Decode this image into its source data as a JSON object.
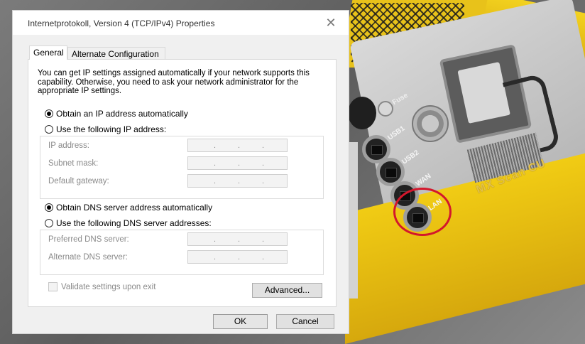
{
  "background": {
    "labels": {
      "fuse": "Fuse",
      "usb1": "USB1",
      "usb2": "USB2",
      "wan": "WAN",
      "lan": "LAN",
      "brand": "MX Scan CU"
    },
    "highlight_color": "#d3172c",
    "case_color": "#f2cf18"
  },
  "dialog": {
    "title": "Internetprotokoll, Version 4 (TCP/IPv4) Properties",
    "close_icon": "close-icon",
    "tabs": [
      {
        "label": "General",
        "active": true
      },
      {
        "label": "Alternate Configuration",
        "active": false
      }
    ],
    "intro": "You can get IP settings assigned automatically if your network supports this capability. Otherwise, you need to ask your network administrator for the appropriate IP settings.",
    "ip_options": {
      "auto": {
        "label": "Obtain an IP address automatically",
        "checked": true
      },
      "manual": {
        "label": "Use the following IP address:",
        "checked": false
      }
    },
    "ip_fields": [
      {
        "label": "IP address:",
        "value": ". . ."
      },
      {
        "label": "Subnet mask:",
        "value": ". . ."
      },
      {
        "label": "Default gateway:",
        "value": ". . ."
      }
    ],
    "dns_options": {
      "auto": {
        "label": "Obtain DNS server address automatically",
        "checked": true
      },
      "manual": {
        "label": "Use the following DNS server addresses:",
        "checked": false
      }
    },
    "dns_fields": [
      {
        "label": "Preferred DNS server:",
        "value": ". . ."
      },
      {
        "label": "Alternate DNS server:",
        "value": ". . ."
      }
    ],
    "validate_label": "Validate settings upon exit",
    "advanced_label": "Advanced...",
    "ok_label": "OK",
    "cancel_label": "Cancel"
  }
}
